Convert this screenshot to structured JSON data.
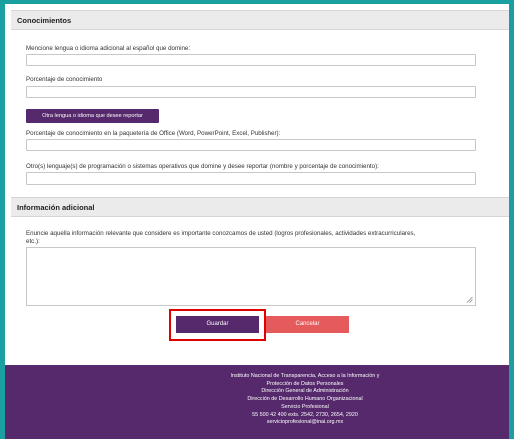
{
  "sections": {
    "knowledge_title": "Conocimientos",
    "additional_title": "Información adicional"
  },
  "fields": {
    "language_label": "Mencione lengua o idioma adicional al español que domine:",
    "percent_label": "Porcentaje de conocimiento",
    "other_language_button": "Otra lengua o idioma que desee reportar",
    "office_label": "Porcentaje de conocimiento en la paquetería de Office (Word, PowerPoint, Excel, Publisher):",
    "programming_label": "Otro(s) lenguaje(s) de programación o sistemas operativos que domine y desee reportar (nombre y porcentaje de conocimiento):",
    "additional_label_line1": "Enuncie aquella información relevante que considere es importante conozcamos de usted (logros profesionales, actividades extracurriculares,",
    "additional_label_line2": "etc.):"
  },
  "actions": {
    "save_label": "Guardar",
    "cancel_label": "Cancelar"
  },
  "footer": {
    "lines": [
      "Instituto Nacional de Transparencia, Acceso a la Información y",
      "Protección de Datos Personales",
      "Dirección General de Administración",
      "Dirección de Desarrollo Humano Organizacional",
      "Servicio Profesional",
      "55 500 42 400 exts. 2542, 2730, 2654, 2920",
      "servicioprofesional@inai.org.mx"
    ]
  },
  "colors": {
    "frame": "#1aa0a0",
    "primary": "#55296b",
    "cancel": "#e55a5a",
    "highlight": "#e00000"
  }
}
